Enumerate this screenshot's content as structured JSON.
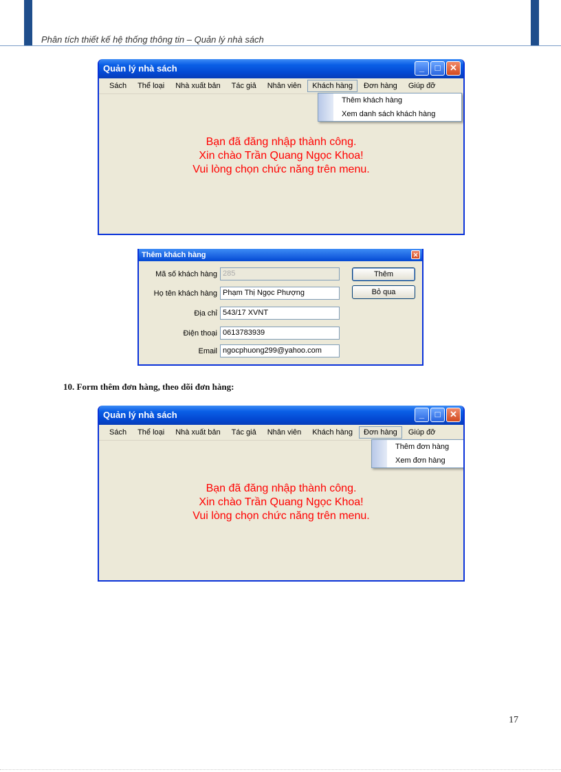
{
  "header": {
    "title": "Phân tích thiết kế hệ thống thông tin – Quản lý nhà sách"
  },
  "window1": {
    "title": "Quản lý nhà sách",
    "menu": [
      "Sách",
      "Thể loại",
      "Nhà xuất bản",
      "Tác giả",
      "Nhân viên",
      "Khách hàng",
      "Đơn hàng",
      "Giúp đỡ"
    ],
    "active_menu": "Khách hàng",
    "dropdown": [
      "Thêm khách hàng",
      "Xem danh sách khách hàng"
    ],
    "welcome": [
      "Bạn đã đăng nhập thành công.",
      "Xin chào Trần Quang Ngọc Khoa!",
      "Vui lòng chọn chức năng trên menu."
    ]
  },
  "dialog": {
    "title": "Thêm khách hàng",
    "fields": [
      {
        "label": "Mã số khách hàng",
        "value": "285"
      },
      {
        "label": "Họ tên khách hàng",
        "value": "Phạm Thị Ngọc Phượng"
      },
      {
        "label": "Địa chỉ",
        "value": "543/17 XVNT"
      },
      {
        "label": "Điện thoại",
        "value": "0613783939"
      },
      {
        "label": "Email",
        "value": "ngocphuong299@yahoo.com"
      }
    ],
    "add_button": "Thêm",
    "skip_button": "Bỏ qua"
  },
  "section_heading": "10. Form  thêm đơn hàng, theo dõi đơn hàng:",
  "window2": {
    "title": "Quản lý nhà sách",
    "menu": [
      "Sách",
      "Thể loại",
      "Nhà xuất bản",
      "Tác giả",
      "Nhân viên",
      "Khách hàng",
      "Đơn hàng",
      "Giúp đỡ"
    ],
    "active_menu": "Đơn hàng",
    "dropdown": [
      "Thêm đơn hàng",
      "Xem đơn hàng"
    ],
    "welcome": [
      "Bạn đã đăng nhập thành công.",
      "Xin chào Trần Quang Ngọc Khoa!",
      "Vui lòng chọn chức năng trên menu."
    ]
  },
  "page_number": "17"
}
